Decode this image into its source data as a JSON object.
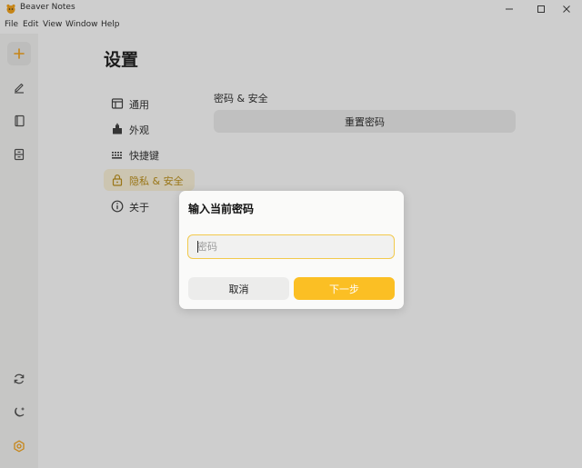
{
  "window": {
    "title": "Beaver Notes",
    "controls": [
      "minimize-icon",
      "maximize-icon",
      "close-icon"
    ]
  },
  "menu": [
    "File",
    "Edit",
    "View",
    "Window",
    "Help"
  ],
  "rail": {
    "top_items": [
      "plus-icon",
      "pencil-icon",
      "notebook-icon",
      "archive-icon"
    ],
    "bottom_items": [
      "sync-icon",
      "moon-icon",
      "settings-icon"
    ]
  },
  "settings": {
    "title": "设置",
    "nav": [
      {
        "label": "通用",
        "icon": "window-icon"
      },
      {
        "label": "外观",
        "icon": "paint-icon"
      },
      {
        "label": "快捷键",
        "icon": "keyboard-icon"
      },
      {
        "label": "隐私 & 安全",
        "icon": "lock-icon",
        "active": true
      },
      {
        "label": "关于",
        "icon": "info-icon"
      }
    ],
    "section_title": "密码 & 安全",
    "reset_button": "重置密码"
  },
  "dialog": {
    "title": "输入当前密码",
    "input_placeholder": "密码",
    "input_value": "",
    "cancel_label": "取消",
    "next_label": "下一步"
  },
  "colors": {
    "accent": "#fbbf24",
    "accent_active_text": "#b8890a",
    "active_nav_bg": "#fdf3d9",
    "input_border": "#f2c94c"
  }
}
